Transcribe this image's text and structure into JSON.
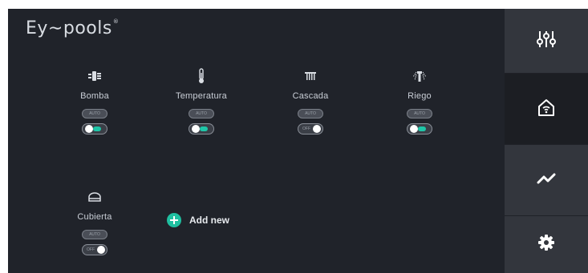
{
  "brand": {
    "name": "Ey∼pools",
    "mark": "®"
  },
  "devices": [
    {
      "icon": "pump-icon",
      "label": "Bomba",
      "mode": "AUTO",
      "toggle_state": "on",
      "toggle_text": ""
    },
    {
      "icon": "thermometer-icon",
      "label": "Temperatura",
      "mode": "AUTO",
      "toggle_state": "on",
      "toggle_text": ""
    },
    {
      "icon": "waterfall-icon",
      "label": "Cascada",
      "mode": "AUTO",
      "toggle_state": "off",
      "toggle_text": "OFF"
    },
    {
      "icon": "irrigation-icon",
      "label": "Riego",
      "mode": "AUTO",
      "toggle_state": "on",
      "toggle_text": ""
    },
    {
      "icon": "pool-cover-icon",
      "label": "Cubierta",
      "mode": "AUTO",
      "toggle_state": "off",
      "toggle_text": "OFF"
    }
  ],
  "add_new": {
    "label": "Add new"
  },
  "sidebar": [
    {
      "icon": "sliders-icon",
      "active": false
    },
    {
      "icon": "smart-home-icon",
      "active": true
    },
    {
      "icon": "trend-chart-icon",
      "active": false
    },
    {
      "icon": "gear-icon",
      "active": false
    }
  ],
  "colors": {
    "accent": "#1fc6a8",
    "background": "#20232a",
    "sidebar": "#33363d",
    "sidebar_active": "#1c1e23"
  }
}
